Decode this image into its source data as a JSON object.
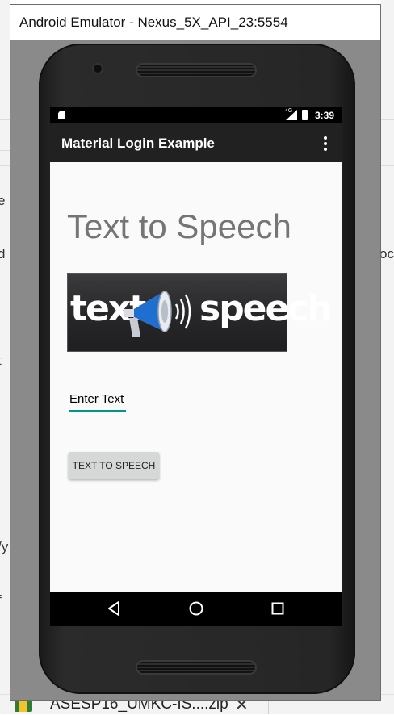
{
  "host": {
    "left_fragments": [
      "e",
      "d",
      "t",
      "/y",
      "f"
    ],
    "right_fragment": "oc",
    "taskbar_item": "ASESP16_UMKC-IS....zip",
    "taskbar_close": "✕"
  },
  "emulator": {
    "window_title": "Android Emulator - Nexus_5X_API_23:5554"
  },
  "phone": {
    "status_bar": {
      "network_label": "4G",
      "time": "3:39"
    },
    "toolbar": {
      "title": "Material Login Example",
      "overflow_icon": "more-vert-icon"
    },
    "content": {
      "heading": "Text to Speech",
      "banner": {
        "word_left": "text",
        "word_right": "speech",
        "icon": "megaphone-icon"
      },
      "text_field": {
        "hint": "Enter Text"
      },
      "button": {
        "label": "TEXT TO SPEECH"
      }
    },
    "nav_bar": {
      "back_icon": "back-triangle-icon",
      "home_icon": "home-circle-icon",
      "recents_icon": "recents-square-icon"
    },
    "colors": {
      "toolbar": "#212121",
      "accent": "#009688",
      "screen_bg": "#fafafa",
      "heading_text": "#757575",
      "button_bg": "#d6d7d7"
    }
  }
}
